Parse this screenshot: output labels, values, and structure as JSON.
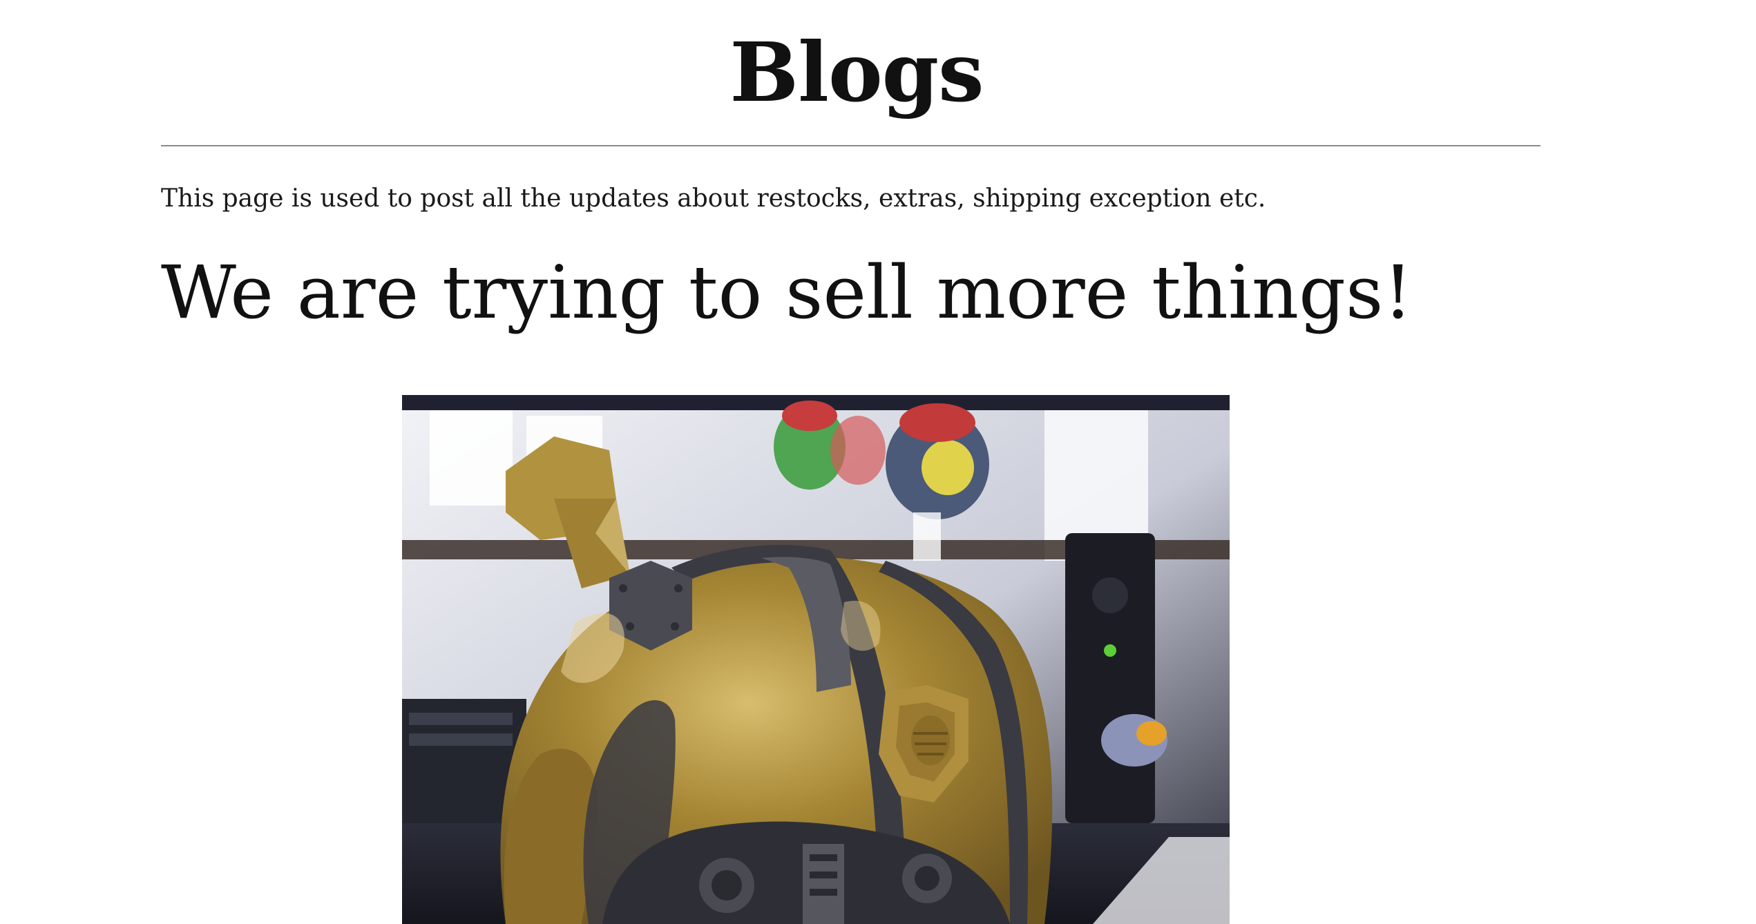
{
  "page": {
    "title": "Blogs",
    "intro": "This page is used to post all the updates about restocks, extras, shipping exception etc."
  },
  "post": {
    "heading": "We are trying to sell more things!",
    "image": {
      "subject": "gold-robot-helmet-photo",
      "colors": {
        "helmet_gold": "#9a7a2c",
        "helmet_highlight": "#d2b868",
        "trim_dark": "#3a3a42",
        "background_light": "#e9ebf2",
        "background_dark": "#20222c"
      }
    }
  }
}
